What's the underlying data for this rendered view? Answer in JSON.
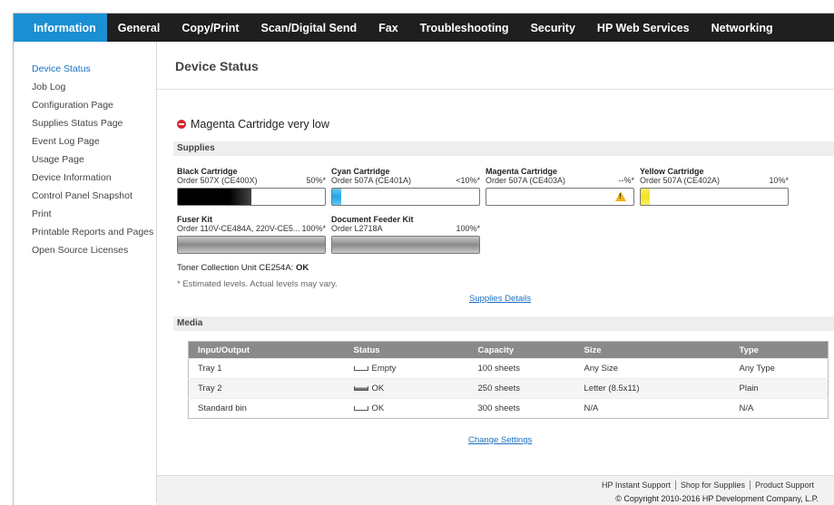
{
  "nav": {
    "tabs": [
      {
        "label": "Information"
      },
      {
        "label": "General"
      },
      {
        "label": "Copy/Print"
      },
      {
        "label": "Scan/Digital Send"
      },
      {
        "label": "Fax"
      },
      {
        "label": "Troubleshooting"
      },
      {
        "label": "Security"
      },
      {
        "label": "HP Web Services"
      },
      {
        "label": "Networking"
      }
    ],
    "active_color": "#1a8fd3"
  },
  "sidebar": {
    "items": [
      {
        "label": "Device Status"
      },
      {
        "label": "Job Log"
      },
      {
        "label": "Configuration Page"
      },
      {
        "label": "Supplies Status Page"
      },
      {
        "label": "Event Log Page"
      },
      {
        "label": "Usage Page"
      },
      {
        "label": "Device Information"
      },
      {
        "label": "Control Panel Snapshot"
      },
      {
        "label": "Print"
      },
      {
        "label": "Printable Reports and Pages"
      },
      {
        "label": "Open Source Licenses"
      }
    ]
  },
  "main": {
    "title": "Device Status",
    "alert": "Magenta Cartridge very low",
    "supplies_header": "Supplies",
    "cartridges": [
      {
        "name": "Black Cartridge",
        "order": "Order 507X (CE400X)",
        "level": "50%*",
        "fill_fraction": 0.5,
        "color": "#111111"
      },
      {
        "name": "Cyan Cartridge",
        "order": "Order 507A (CE401A)",
        "level": "<10%*",
        "fill_fraction": 0.06,
        "color": "#1fa6e8"
      },
      {
        "name": "Magenta Cartridge",
        "order": "Order 507A (CE403A)",
        "level": "--%*",
        "fill_fraction": 0,
        "color": "#d4237c"
      },
      {
        "name": "Yellow Cartridge",
        "order": "Order 507A (CE402A)",
        "level": "10%*",
        "fill_fraction": 0.06,
        "color": "#f4e31a"
      }
    ],
    "kits": [
      {
        "name": "Fuser Kit",
        "order": "Order 110V-CE484A, 220V-CE5...",
        "level": "100%*",
        "fill_fraction": 1,
        "color": "#9a9a9a"
      },
      {
        "name": "Document Feeder Kit",
        "order": "Order L2718A",
        "level": "100%*",
        "fill_fraction": 1,
        "color": "#9a9a9a"
      }
    ],
    "toner_label": "Toner Collection Unit CE254A:",
    "toner_status": "OK",
    "note": "* Estimated levels. Actual levels may vary.",
    "supplies_details_link": "Supplies Details",
    "media_header": "Media",
    "media_columns": [
      "Input/Output",
      "Status",
      "Capacity",
      "Size",
      "Type"
    ],
    "media_rows": [
      {
        "io": "Tray 1",
        "status": "Empty",
        "capacity": "100 sheets",
        "size": "Any Size",
        "type": "Any Type"
      },
      {
        "io": "Tray 2",
        "status": "OK",
        "capacity": "250 sheets",
        "size": "Letter (8.5x11)",
        "type": "Plain"
      },
      {
        "io": "Standard bin",
        "status": "OK",
        "capacity": "300 sheets",
        "size": "N/A",
        "type": "N/A"
      }
    ],
    "change_settings_link": "Change Settings"
  },
  "footer": {
    "links": [
      "HP Instant Support",
      "Shop for Supplies",
      "Product Support"
    ],
    "copyright": "© Copyright 2010-2016 HP Development Company, L.P."
  }
}
